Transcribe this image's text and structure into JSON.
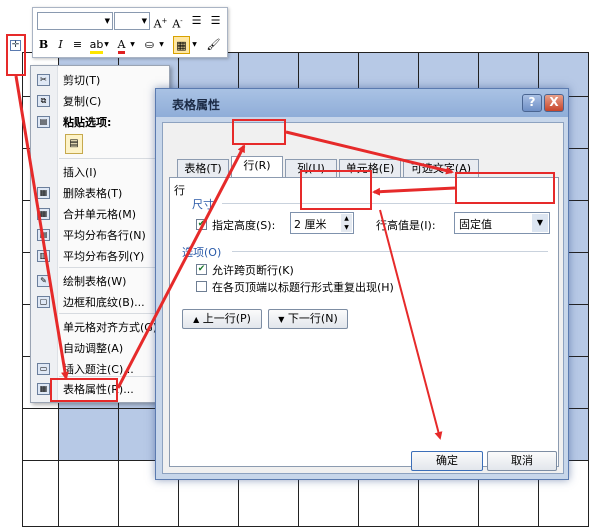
{
  "toolbar": {
    "font_size_value": "",
    "font_name_value": ""
  },
  "context_menu": {
    "items": [
      {
        "label": "剪切(T)",
        "icon": "scissors-icon",
        "submenu": false
      },
      {
        "label": "复制(C)",
        "icon": "copy-icon",
        "submenu": false
      },
      {
        "label": "粘贴选项:",
        "icon": "clipboard-icon",
        "submenu": false
      },
      {
        "label": "插入(I)",
        "icon": "",
        "submenu": true
      },
      {
        "label": "删除表格(T)",
        "icon": "delete-table-icon",
        "submenu": false
      },
      {
        "label": "合并单元格(M)",
        "icon": "merge-cells-icon",
        "submenu": false
      },
      {
        "label": "平均分布各行(N)",
        "icon": "distribute-rows-icon",
        "submenu": false
      },
      {
        "label": "平均分布各列(Y)",
        "icon": "distribute-columns-icon",
        "submenu": false
      },
      {
        "label": "绘制表格(W)",
        "icon": "draw-table-icon",
        "submenu": false
      },
      {
        "label": "边框和底纹(B)...",
        "icon": "borders-icon",
        "submenu": false
      },
      {
        "label": "单元格对齐方式(G)",
        "icon": "",
        "submenu": true
      },
      {
        "label": "自动调整(A)",
        "icon": "",
        "submenu": true
      },
      {
        "label": "插入题注(C)...",
        "icon": "caption-icon",
        "submenu": false
      },
      {
        "label": "表格属性(R)...",
        "icon": "table-properties-icon",
        "submenu": false
      }
    ]
  },
  "dialog": {
    "title": "表格属性",
    "help": "?",
    "close": "X",
    "tabs": [
      "表格(T)",
      "行(R)",
      "列(U)",
      "单元格(E)",
      "可选文字(A)"
    ],
    "active_tab": "行(R)",
    "section_row": "行",
    "section_size": "尺寸",
    "specify_height_label": "指定高度(S):",
    "height_value": "2 厘米",
    "row_height_is_label": "行高值是(I):",
    "row_height_mode": "固定值",
    "options_label": "选项(O)",
    "allow_break_label": "允许跨页断行(K)",
    "repeat_header_label": "在各页顶端以标题行形式重复出现(H)",
    "prev_row": "上一行(P)",
    "next_row": "下一行(N)",
    "ok": "确定",
    "cancel": "取消"
  },
  "colors": {
    "selection": "#b7c9e6",
    "annotation": "#e62a2a",
    "dialog_frame": "#8fadd8"
  }
}
